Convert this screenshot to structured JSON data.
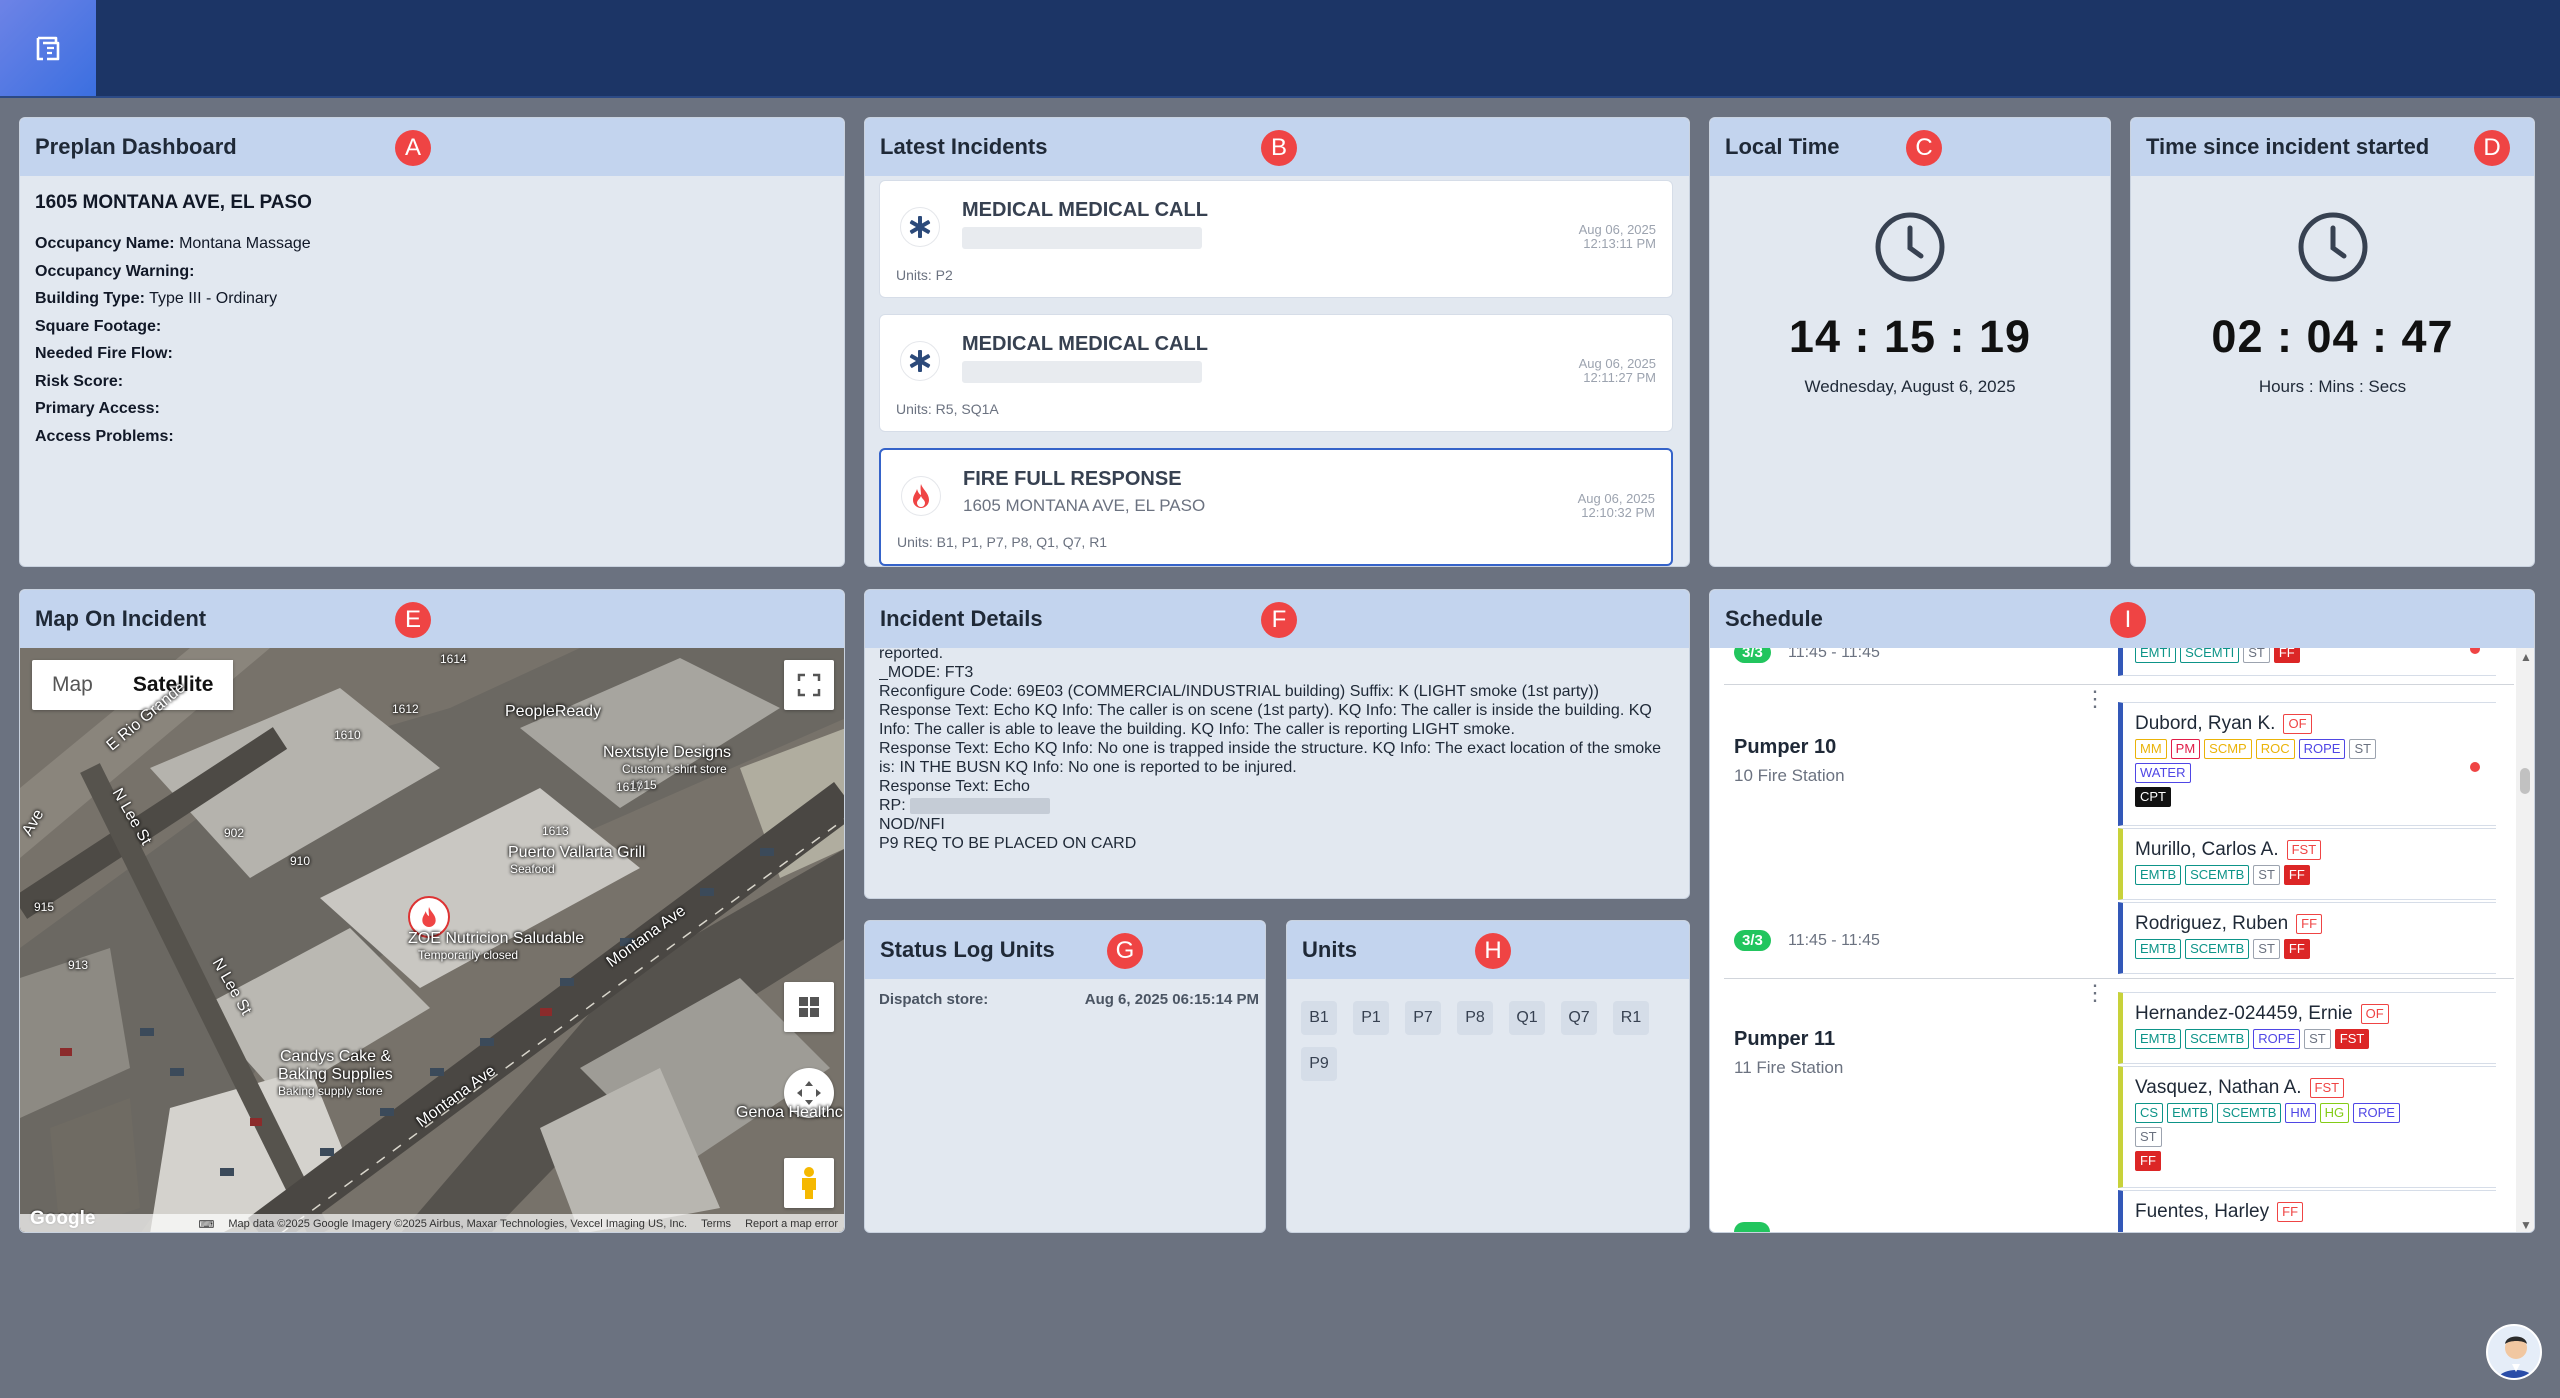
{
  "markers": {
    "a": "A",
    "b": "B",
    "c": "C",
    "d": "D",
    "e": "E",
    "f": "F",
    "g": "G",
    "h": "H",
    "i": "I"
  },
  "preplan": {
    "title": "Preplan Dashboard",
    "address": "1605 MONTANA AVE, EL PASO",
    "rows": [
      {
        "label": "Occupancy Name:",
        "value": "Montana Massage"
      },
      {
        "label": "Occupancy Warning:",
        "value": ""
      },
      {
        "label": "Building Type:",
        "value": "Type III - Ordinary"
      },
      {
        "label": "Square Footage:",
        "value": ""
      },
      {
        "label": "Needed Fire Flow:",
        "value": ""
      },
      {
        "label": "Risk Score:",
        "value": ""
      },
      {
        "label": "Primary Access:",
        "value": ""
      },
      {
        "label": "Access Problems:",
        "value": ""
      }
    ]
  },
  "incidents": {
    "title": "Latest Incidents",
    "items": [
      {
        "icon": "medical-star-icon",
        "title": "MEDICAL MEDICAL CALL",
        "address": "",
        "date": "Aug 06, 2025",
        "time": "12:13:11 PM",
        "units": "Units: P2"
      },
      {
        "icon": "medical-star-icon",
        "title": "MEDICAL MEDICAL CALL",
        "address": "",
        "date": "Aug 06, 2025",
        "time": "12:11:27 PM",
        "units": "Units: R5, SQ1A"
      },
      {
        "icon": "fire-icon",
        "title": "FIRE FULL RESPONSE",
        "address": "1605 MONTANA AVE, EL PASO",
        "date": "Aug 06, 2025",
        "time": "12:10:32 PM",
        "units": "Units: B1, P1, P7, P8, Q1, Q7, R1"
      }
    ]
  },
  "local_time": {
    "title": "Local Time",
    "time": "14 : 15 : 19",
    "date": "Wednesday, August 6, 2025"
  },
  "elapsed": {
    "title": "Time since incident started",
    "time": "02 : 04 : 47",
    "caption": "Hours : Mins : Secs"
  },
  "map": {
    "title": "Map On Incident",
    "tab_map": "Map",
    "tab_satellite": "Satellite",
    "labels": {
      "rio_grande": "E Rio Grande",
      "lee_st_1": "N Lee St",
      "lee_st_2": "N Lee St",
      "montana_1": "Montana Ave",
      "montana_2": "Montana Ave",
      "peopleready": "PeopleReady",
      "nextstyle": "Nextstyle Designs",
      "nextstyle_sub": "Custom t-shirt store",
      "puerto": "Puerto Vallarta Grill",
      "puerto_sub": "Seafood",
      "zoe": "ZOE Nutricion Saludable",
      "zoe_sub": "Temporarily closed",
      "candys": "Candys Cake &",
      "candys_2": "Baking Supplies",
      "candys_sub": "Baking supply store",
      "genoa": "Genoa Healthc",
      "ave": "Ave",
      "n1614": "1614",
      "n1612": "1612",
      "n1610": "1610",
      "n1615": "1615",
      "n1617": "1617",
      "n1613": "1613",
      "n902": "902",
      "n910": "910",
      "n915": "915",
      "n913": "913"
    },
    "google": "Google",
    "footer_data": "Map data ©2025 Google Imagery ©2025 Airbus, Maxar Technologies, Vexcel Imaging US, Inc.",
    "footer_terms": "Terms",
    "footer_report": "Report a map error"
  },
  "details": {
    "title": "Incident Details",
    "lines": [
      "reported.",
      "_MODE: FT3",
      "Reconfigure Code: 69E03 (COMMERCIAL/INDUSTRIAL building) Suffix: K (LIGHT smoke (1st party))",
      "Response Text: Echo KQ Info: The caller is on scene (1st party). KQ Info: The caller is inside the building. KQ Info: The caller is able to leave the building. KQ Info: The caller is reporting LIGHT smoke.",
      "Response Text: Echo KQ Info: No one is trapped inside the structure. KQ Info: The exact location of the smoke is: IN THE BUSN KQ Info: No one is reported to be injured.",
      "Response Text: Echo",
      "RP:",
      "NOD/NFI",
      "P9 REQ TO BE PLACED ON CARD"
    ]
  },
  "status_log": {
    "title": "Status Log Units",
    "label": "Dispatch store:",
    "value": "Aug 6, 2025 06:15:14 PM"
  },
  "units": {
    "title": "Units",
    "chips": [
      "B1",
      "P1",
      "P7",
      "P8",
      "Q1",
      "Q7",
      "R1",
      "P9"
    ]
  },
  "schedule": {
    "title": "Schedule",
    "top_badge": "3/3",
    "top_time": "11:45 - 11:45",
    "top_tags": [
      "EMTI",
      "SCEMTI",
      "ST",
      "FF"
    ],
    "groups": [
      {
        "name": "Pumper 10",
        "station": "10 Fire Station",
        "badge": "3/3",
        "time": "11:45 - 11:45",
        "people": [
          {
            "name": "Dubord, Ryan K.",
            "rank": "OF",
            "tags": [
              "MM",
              "PM",
              "SCMP",
              "ROC",
              "ROPE",
              "ST",
              "WATER",
              "CPT"
            ]
          },
          {
            "name": "Murillo, Carlos A.",
            "rank": "FST",
            "tags": [
              "EMTB",
              "SCEMTB",
              "ST",
              "FF"
            ]
          },
          {
            "name": "Rodriguez, Ruben",
            "rank": "FF",
            "tags": [
              "EMTB",
              "SCEMTB",
              "ST",
              "FF"
            ]
          }
        ]
      },
      {
        "name": "Pumper 11",
        "station": "11 Fire Station",
        "people": [
          {
            "name": "Hernandez-024459, Ernie",
            "rank": "OF",
            "tags": [
              "EMTB",
              "SCEMTB",
              "ROPE",
              "ST",
              "FST"
            ]
          },
          {
            "name": "Vasquez, Nathan A.",
            "rank": "FST",
            "tags": [
              "CS",
              "EMTB",
              "SCEMTB",
              "HM",
              "HG",
              "ROPE",
              "ST",
              "FF"
            ]
          },
          {
            "name": "Fuentes, Harley",
            "rank": "FF",
            "tags": []
          }
        ]
      }
    ]
  }
}
